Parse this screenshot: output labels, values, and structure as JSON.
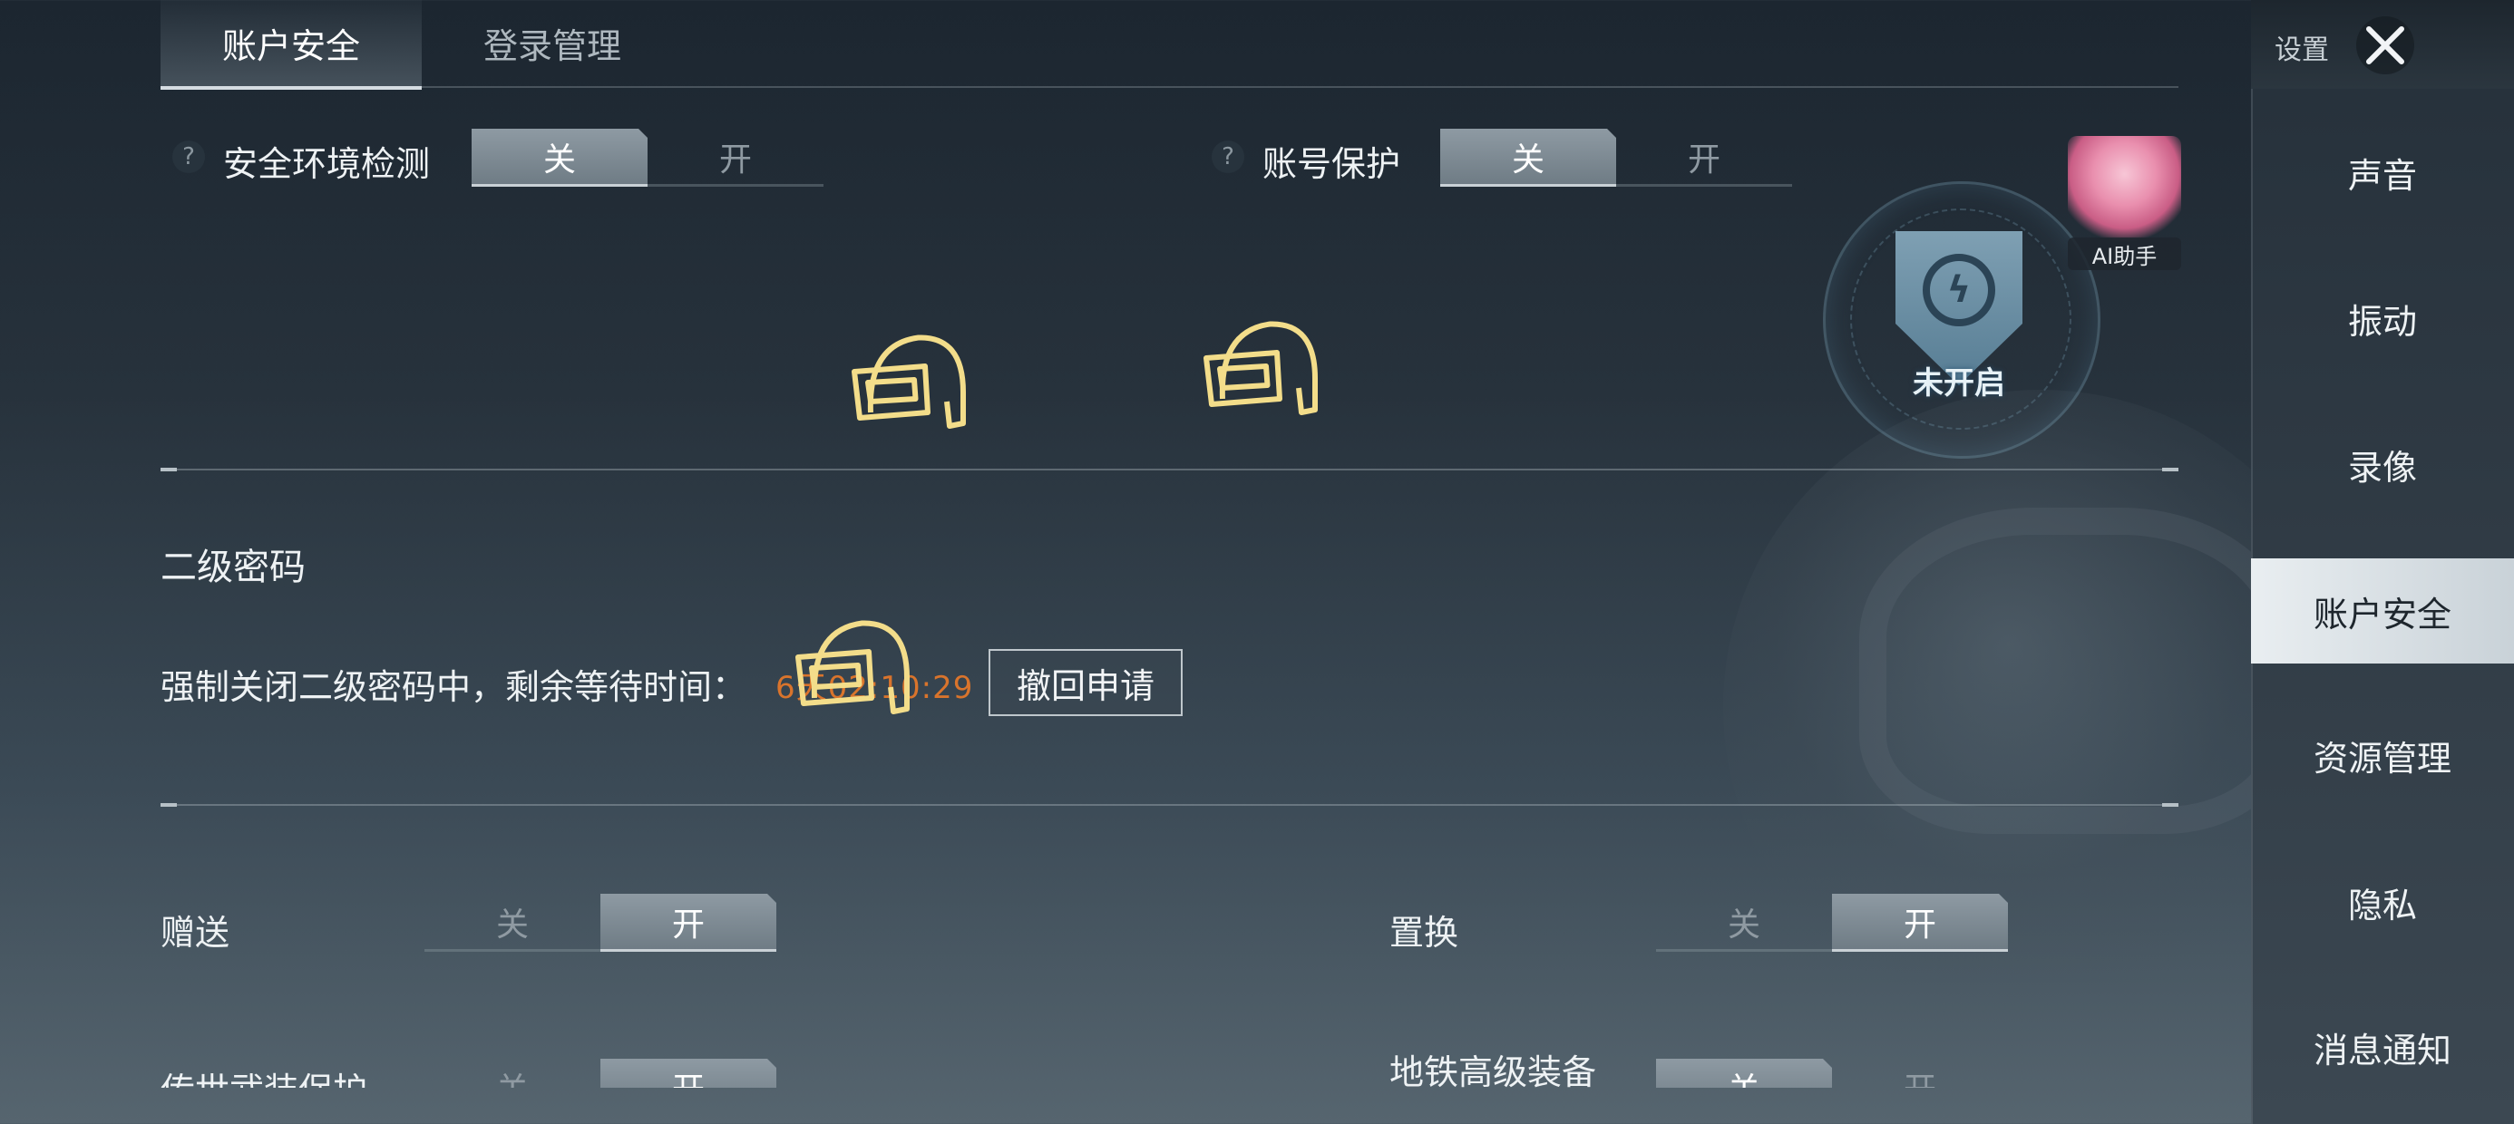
{
  "tabs": [
    {
      "label": "账户安全",
      "active": true
    },
    {
      "label": "登录管理",
      "active": false
    }
  ],
  "security_env": {
    "help": "?",
    "label": "安全环境检测",
    "off": "关",
    "on": "开",
    "state": "off"
  },
  "account_protect": {
    "help": "?",
    "label": "账号保护",
    "off": "关",
    "on": "开",
    "state": "off"
  },
  "protect_badge": {
    "status": "未开启"
  },
  "ai_assistant": {
    "label": "AI助手"
  },
  "second_password": {
    "title": "二级密码",
    "status_text": "强制关闭二级密码中，剩余等待时间：",
    "countdown": "6天02:10:29",
    "revoke_button": "撤回申请"
  },
  "gift": {
    "label": "赠送",
    "off": "关",
    "on": "开",
    "state": "on"
  },
  "exchange": {
    "label": "置换",
    "off": "关",
    "on": "开",
    "state": "on"
  },
  "legend_gear": {
    "label": "传世武装保护",
    "off": "关",
    "on": "开",
    "state": "on"
  },
  "metro_gear": {
    "label": "地铁高级装备",
    "off": "关",
    "on": "开",
    "state": "off"
  },
  "sidebar": {
    "title": "设置",
    "items": [
      {
        "label": "声音",
        "active": false
      },
      {
        "label": "振动",
        "active": false
      },
      {
        "label": "录像",
        "active": false
      },
      {
        "label": "账户安全",
        "active": true
      },
      {
        "label": "资源管理",
        "active": false
      },
      {
        "label": "隐私",
        "active": false
      },
      {
        "label": "消息通知",
        "active": false
      }
    ]
  },
  "icons": [
    "help-icon",
    "helmet-icon",
    "shield-icon",
    "close-icon"
  ],
  "colors": {
    "accent_orange": "#d9742c",
    "active_tab": "#e9eef1"
  }
}
